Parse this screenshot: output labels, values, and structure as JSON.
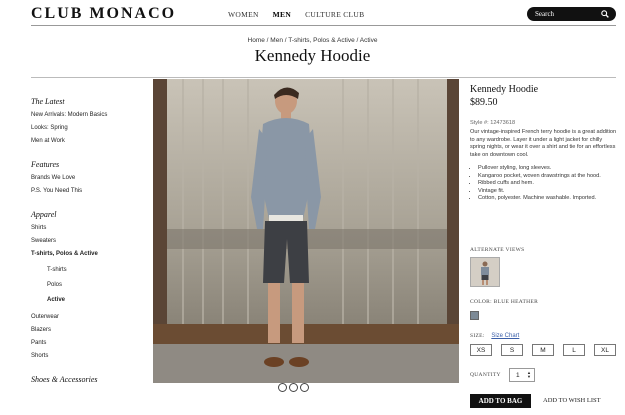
{
  "header": {
    "logo": "CLUB MONACO",
    "nav": [
      "WOMEN",
      "MEN",
      "CULTURE CLUB"
    ],
    "active_nav": "MEN",
    "search_placeholder": "Search"
  },
  "breadcrumb": "Home / Men / T-shirts, Polos & Active / Active",
  "product": {
    "title": "Kennedy Hoodie",
    "name": "Kennedy Hoodie",
    "price": "$89.50",
    "style": "Style #: 12473618",
    "description": "Our vintage-inspired French terry hoodie is a great addition to any wardrobe. Layer it under a light jacket for chilly spring nights, or wear it over a shirt and tie for an effortless take on downtown cool.",
    "features": [
      "Pullover styling, long sleeves.",
      "Kangaroo pocket, woven drawstrings at the hood.",
      "Ribbed cuffs and hem.",
      "Vintage fit.",
      "Cotton, polyester. Machine washable. Imported."
    ],
    "alternate_views_label": "ALTERNATE VIEWS",
    "color_label": "COLOR: BLUE HEATHER",
    "size_label": "SIZE:",
    "size_chart": "Size Chart",
    "sizes": [
      "XS",
      "S",
      "M",
      "L",
      "XL"
    ],
    "quantity_label": "QUANTITY",
    "quantity_value": "1",
    "add_to_bag": "ADD TO BAG",
    "add_to_wishlist": "ADD TO WISH LIST"
  },
  "sidebar": {
    "latest_heading": "The Latest",
    "latest": [
      "New Arrivals: Modern Basics",
      "Looks: Spring",
      "Men at Work"
    ],
    "features_heading": "Features",
    "features": [
      "Brands We Love",
      "P.S. You Need This"
    ],
    "apparel_heading": "Apparel",
    "apparel_top": [
      "Shirts",
      "Sweaters"
    ],
    "apparel_current": "T-shirts, Polos & Active",
    "apparel_sub": [
      "T-shirts",
      "Polos",
      "Active"
    ],
    "apparel_bottom": [
      "Outerwear",
      "Blazers",
      "Pants",
      "Shorts"
    ],
    "shoes_heading": "Shoes & Accessories"
  },
  "colors": {
    "accent": "#111111",
    "swatch": "#7d8a96"
  }
}
